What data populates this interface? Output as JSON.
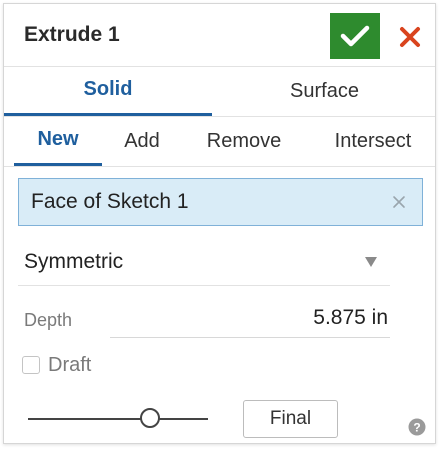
{
  "header": {
    "title": "Extrude 1",
    "ok_icon": "checkmark-icon",
    "cancel_icon": "close-icon",
    "ok_color": "#2e8b2e",
    "cancel_color": "#d9441e"
  },
  "body_tabs": {
    "items": [
      {
        "label": "Solid",
        "selected": true
      },
      {
        "label": "Surface",
        "selected": false
      }
    ]
  },
  "operation_tabs": {
    "items": [
      {
        "label": "New",
        "selected": true
      },
      {
        "label": "Add",
        "selected": false
      },
      {
        "label": "Remove",
        "selected": false
      },
      {
        "label": "Intersect",
        "selected": false
      }
    ]
  },
  "selection": {
    "value": "Face of Sketch 1",
    "clear_icon": "clear-icon"
  },
  "end_type": {
    "value": "Symmetric",
    "icon": "dropdown-arrow-icon"
  },
  "depth": {
    "label": "Depth",
    "value": "5.875 in"
  },
  "draft": {
    "label": "Draft",
    "checked": false
  },
  "footer": {
    "final_label": "Final",
    "help_icon": "help-icon"
  },
  "colors": {
    "accent": "#1f5f9e",
    "selection_bg": "#d9ecf7"
  }
}
